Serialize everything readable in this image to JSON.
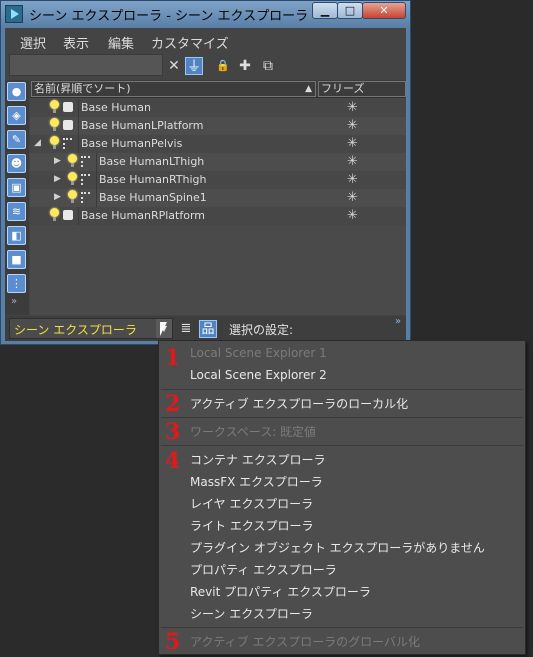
{
  "window": {
    "title": "シーン エクスプローラ - シーン エクスプローラ",
    "minimize_glyph": "▁",
    "maximize_glyph": "□",
    "close_glyph": "✕"
  },
  "menubar": [
    "選択",
    "表示",
    "編集",
    "カスタマイズ"
  ],
  "search": {
    "value": "",
    "placeholder": ""
  },
  "toolbar": {
    "clear_glyph": "✕",
    "filter_glyph": "⏚",
    "lock_glyph": "🔒",
    "select_plus_glyph": "✚",
    "select_children_glyph": "⧉"
  },
  "left_toolbar": {
    "buttons": [
      "●",
      "◈",
      "✎",
      "☻",
      "▣",
      "≋",
      "◧",
      "■",
      "⋮"
    ],
    "more_glyph": "»"
  },
  "grid": {
    "columns": {
      "name": "名前(昇順でソート)",
      "sort_glyph": "▲",
      "freeze": "フリーズ"
    },
    "rows": [
      {
        "name": "Base Human",
        "expander": "",
        "type": "mesh",
        "freeze": "✳"
      },
      {
        "name": "Base HumanLPlatform",
        "expander": "",
        "type": "mesh",
        "freeze": "✳"
      },
      {
        "name": "Base HumanPelvis",
        "expander": "◢",
        "type": "bone",
        "freeze": "✳"
      },
      {
        "name": "Base HumanLThigh",
        "expander": "▶",
        "type": "bone",
        "freeze": "✳"
      },
      {
        "name": "Base HumanRThigh",
        "expander": "▶",
        "type": "bone",
        "freeze": "✳"
      },
      {
        "name": "Base HumanSpine1",
        "expander": "▶",
        "type": "bone",
        "freeze": "✳"
      },
      {
        "name": "Base HumanRPlatform",
        "expander": "",
        "type": "mesh",
        "freeze": "✳"
      }
    ]
  },
  "bottom_bar": {
    "explorer_dropdown": "シーン エクスプローラ",
    "dropdown_arrow": "▼",
    "layers_glyph": "≣",
    "hierarchy_glyph": "品",
    "selection_settings_label": "選択の設定:",
    "more_glyph": "»"
  },
  "popup_menu": {
    "badges": [
      "1",
      "2",
      "3",
      "4",
      "5"
    ],
    "items": [
      {
        "label": "Local Scene Explorer 1",
        "enabled": false
      },
      {
        "label": "Local Scene Explorer 2",
        "enabled": true
      },
      {
        "label": "アクティブ エクスプローラのローカル化",
        "enabled": true
      },
      {
        "label": "ワークスペース: 既定値",
        "enabled": false
      },
      {
        "label": "コンテナ エクスプローラ",
        "enabled": true
      },
      {
        "label": "MassFX エクスプローラ",
        "enabled": true
      },
      {
        "label": "レイヤ エクスプローラ",
        "enabled": true
      },
      {
        "label": "ライト エクスプローラ",
        "enabled": true
      },
      {
        "label": "プラグイン オブジェクト エクスプローラがありません",
        "enabled": true
      },
      {
        "label": "プロパティ エクスプローラ",
        "enabled": true
      },
      {
        "label": "Revit プロパティ エクスプローラ",
        "enabled": true
      },
      {
        "label": "シーン エクスプローラ",
        "enabled": true
      },
      {
        "label": "アクティブ エクスプローラのグローバル化",
        "enabled": false
      }
    ]
  },
  "colors": {
    "accent_blue": "#4f84c4",
    "dropdown_text": "#f0e040",
    "badge_red": "#e01a1a",
    "panel_bg": "#444444"
  }
}
